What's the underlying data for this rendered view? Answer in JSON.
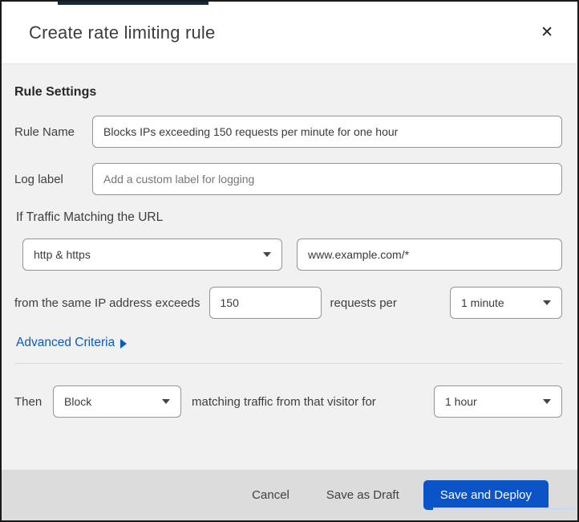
{
  "modal": {
    "title": "Create rate limiting rule",
    "close_glyph": "✕"
  },
  "rule_settings": {
    "heading": "Rule Settings",
    "rule_name": {
      "label": "Rule Name",
      "value": "Blocks IPs exceeding 150 requests per minute for one hour"
    },
    "log_label": {
      "label": "Log label",
      "placeholder": "Add a custom label for logging"
    },
    "traffic_match": {
      "heading": "If Traffic Matching the URL",
      "scheme_selected": "http & https",
      "url_value": "www.example.com/*"
    },
    "threshold": {
      "prefix_text": "from the same IP address exceeds",
      "requests_value": "150",
      "middle_text": "requests per",
      "period_selected": "1 minute"
    },
    "advanced_criteria_label": "Advanced Criteria"
  },
  "action": {
    "then_label": "Then",
    "action_selected": "Block",
    "middle_text": "matching traffic from that visitor for",
    "duration_selected": "1 hour"
  },
  "footer": {
    "cancel_label": "Cancel",
    "save_draft_label": "Save as Draft",
    "save_deploy_label": "Save and Deploy"
  },
  "colors": {
    "primary_button_blue": "#0b54c8",
    "link_blue": "#0a5ac6",
    "body_background": "#f1f1f1",
    "footer_background": "#dcdcdc"
  }
}
